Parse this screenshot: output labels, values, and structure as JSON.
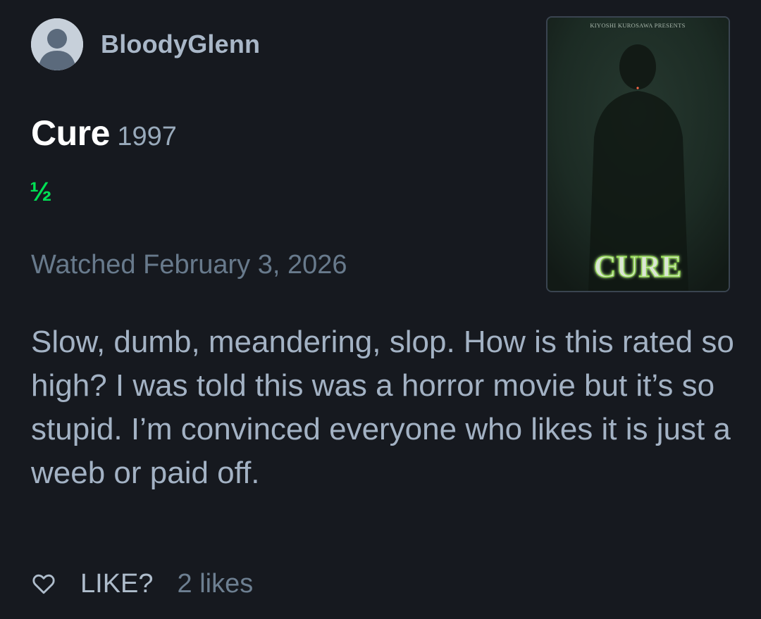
{
  "user": {
    "username": "BloodyGlenn"
  },
  "film": {
    "title": "Cure",
    "year": "1997",
    "rating_text": "½",
    "rating_stars": 0.5,
    "poster": {
      "top_text": "KIYOSHI KUROSAWA PRESENTS",
      "title_text": "CURE"
    }
  },
  "entry": {
    "watched": "Watched February 3, 2026",
    "review": "Slow, dumb, meandering, slop. How is this rated so high? I was told this was a horror movie but it’s so stupid. I’m convinced everyone who likes it is just a weeb or paid off."
  },
  "actions": {
    "like_label": "LIKE?",
    "likes_count": "2 likes",
    "like_icon": "heart-outline-icon"
  },
  "colors": {
    "background": "#16191f",
    "rating_green": "#00e054",
    "title_white": "#ffffff",
    "text_primary": "#a3b2c4",
    "text_muted": "#687a8c"
  }
}
